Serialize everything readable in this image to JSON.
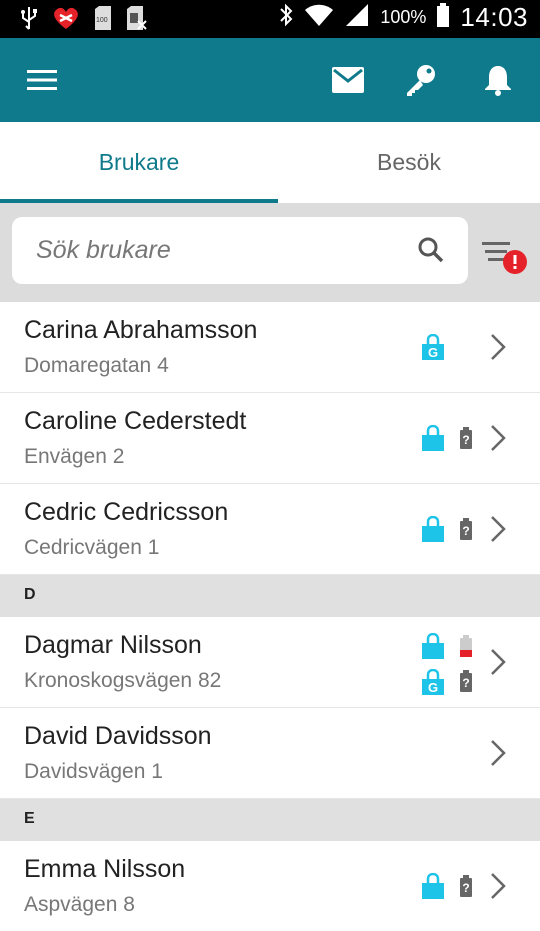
{
  "status_bar": {
    "battery_percent": "100%",
    "time": "14:03",
    "left_icons": [
      "usb-icon",
      "heart-app-icon",
      "sd-card-icon",
      "no-sim-icon"
    ],
    "right_icons": [
      "bluetooth-icon",
      "wifi-icon",
      "signal-icon",
      "battery-icon"
    ]
  },
  "toolbar": {
    "color": "#0f7a8b",
    "icons": [
      "menu-icon",
      "mail-icon",
      "key-icon",
      "bell-icon"
    ]
  },
  "tabs": [
    {
      "label": "Brukare",
      "active": true
    },
    {
      "label": "Besök",
      "active": false
    }
  ],
  "search": {
    "placeholder": "Sök brukare",
    "value": ""
  },
  "list": {
    "rows": [
      {
        "name": "Carina Abrahamsson",
        "address": "Domaregatan 4",
        "icons": [
          "lock-g-icon"
        ]
      },
      {
        "name": "Caroline Cederstedt",
        "address": "Envägen 2",
        "icons": [
          "lock-icon",
          "battery-unknown-icon"
        ]
      },
      {
        "name": "Cedric Cedricsson",
        "address": "Cedricvägen 1",
        "icons": [
          "lock-icon",
          "battery-unknown-icon"
        ]
      }
    ],
    "section_d": "D",
    "rows_d": [
      {
        "name": "Dagmar Nilsson",
        "address": "Kronoskogsvägen 82",
        "icons": [
          "lock-icon",
          "battery-low-icon",
          "lock-g-icon",
          "battery-unknown-icon"
        ]
      },
      {
        "name": "David Davidsson",
        "address": "Davidsvägen 1",
        "icons": []
      }
    ],
    "section_e": "E",
    "rows_e": [
      {
        "name": "Emma Nilsson",
        "address": "Aspvägen 8",
        "icons": [
          "lock-icon",
          "battery-unknown-icon"
        ]
      }
    ]
  },
  "colors": {
    "accent": "#0f7a8b",
    "lock": "#1ec3e8",
    "alert": "#e52229"
  }
}
